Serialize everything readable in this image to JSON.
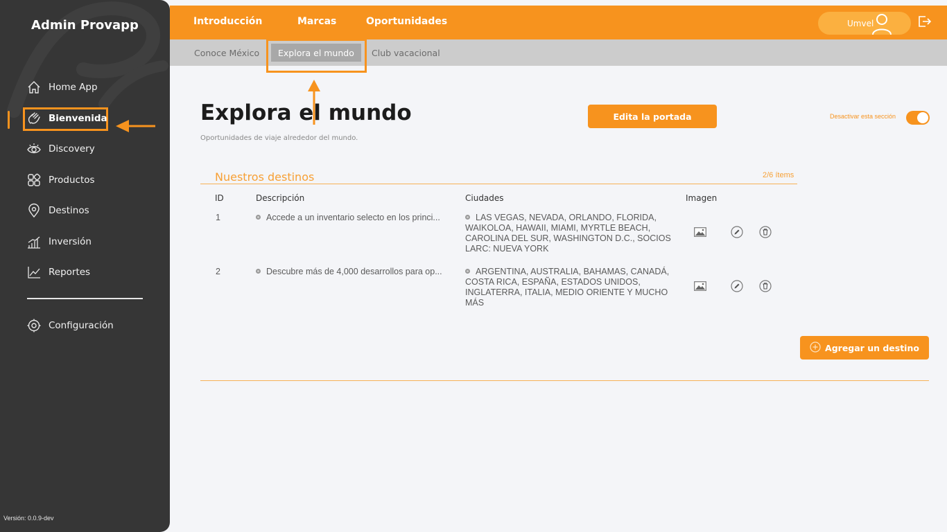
{
  "app": {
    "brand": "Admin Provapp",
    "version": "Versión: 0.0.9-dev"
  },
  "colors": {
    "accent": "#f7931e",
    "sidebar": "#363636",
    "subbar": "#cccccc"
  },
  "sidebar": {
    "items": [
      {
        "label": "Home App",
        "icon": "home-icon"
      },
      {
        "label": "Bienvenida",
        "icon": "waving-hand-icon",
        "active": true
      },
      {
        "label": "Discovery",
        "icon": "eye-icon"
      },
      {
        "label": "Productos",
        "icon": "grid-icon"
      },
      {
        "label": "Destinos",
        "icon": "location-pin-icon"
      },
      {
        "label": "Inversión",
        "icon": "bar-chart-icon"
      },
      {
        "label": "Reportes",
        "icon": "line-chart-icon"
      }
    ],
    "settings": {
      "label": "Configuración",
      "icon": "gear-icon"
    }
  },
  "topnav": {
    "tabs": [
      {
        "label": "Introducción"
      },
      {
        "label": "Marcas"
      },
      {
        "label": "Oportunidades",
        "active": true
      }
    ],
    "user": {
      "name": "Umvel",
      "icon": "user-icon"
    },
    "logout_icon": "logout-icon"
  },
  "subnav": {
    "tabs": [
      {
        "label": "Conoce México"
      },
      {
        "label": "Explora el mundo",
        "active": true
      },
      {
        "label": "Club vacacional"
      }
    ]
  },
  "main": {
    "title": "Explora el mundo",
    "subtitle": "Oportunidades de viaje alrededor del mundo.",
    "edit_cover_label": "Edita la portada",
    "toggle_label": "Desactivar esta sección",
    "toggle_on": true,
    "section": {
      "title": "Nuestros destinos",
      "count": "2/6 ítems",
      "columns": [
        "ID",
        "Descripción",
        "Ciudades",
        "Imagen"
      ],
      "rows": [
        {
          "id": "1",
          "description": "Accede a un inventario selecto en los princi...",
          "cities": "LAS VEGAS, NEVADA, ORLANDO, FLORIDA, WAIKOLOA, HAWAII, MIAMI, MYRTLE BEACH, CAROLINA DEL SUR, WASHINGTON D.C., SOCIOS LARC: NUEVA YORK"
        },
        {
          "id": "2",
          "description": "Descubre más de 4,000 desarrollos para op...",
          "cities": "ARGENTINA, AUSTRALIA, BAHAMAS, CANADÁ, COSTA RICA, ESPAÑA, ESTADOS UNIDOS, INGLATERRA, ITALIA, MEDIO ORIENTE Y MUCHO MÁS"
        }
      ]
    },
    "add_label": "Agregar un destino"
  }
}
